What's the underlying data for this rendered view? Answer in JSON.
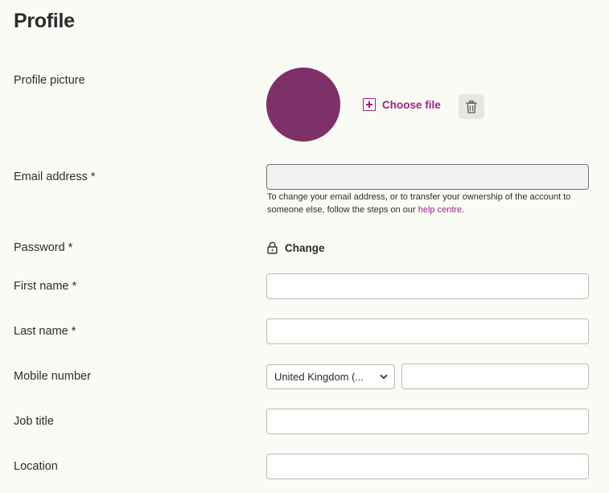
{
  "page": {
    "title": "Profile"
  },
  "labels": {
    "profile_picture": "Profile picture",
    "email": "Email address *",
    "password": "Password *",
    "first_name": "First name *",
    "last_name": "Last name *",
    "mobile": "Mobile number",
    "job_title": "Job title",
    "location": "Location"
  },
  "avatar": {
    "color": "#7e3068"
  },
  "actions": {
    "choose_file": "Choose file",
    "choose_file_icon": "plus-square-icon",
    "delete_icon": "trash-icon"
  },
  "email": {
    "value": "",
    "help_prefix": "To change your email address, or to transfer your ownership of the account to someone else, follow the steps on our ",
    "help_link": "help centre",
    "help_suffix": "."
  },
  "password": {
    "change_label": "Change",
    "icon": "lock-icon"
  },
  "fields": {
    "first_name": "",
    "last_name": "",
    "mobile_country": "United Kingdom (...",
    "mobile_number": "",
    "job_title": "",
    "location": ""
  },
  "colors": {
    "accent": "#9e1f86",
    "background": "#fbfbf6"
  }
}
